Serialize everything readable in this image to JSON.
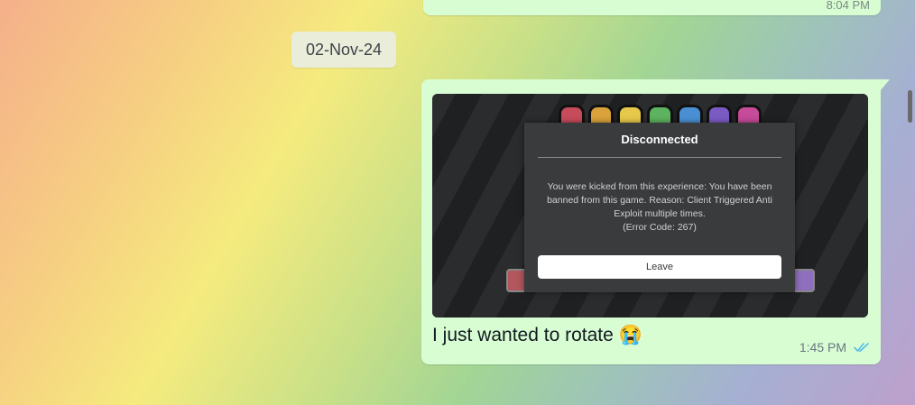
{
  "previous_message": {
    "time": "8:04 PM"
  },
  "date_divider": {
    "label": "02-Nov-24"
  },
  "message": {
    "caption": "I just wanted to rotate 😭",
    "time": "1:45 PM",
    "status": "read",
    "status_icon": "double-check-icon",
    "image": {
      "dialog_title": "Disconnected",
      "dialog_body": "You were kicked from this experience: You have been banned from this game. Reason: Client Triggered Anti Exploit multiple times.",
      "error_code": "(Error Code: 267)",
      "leave_label": "Leave"
    }
  },
  "colors": {
    "bubble": "#d9fdd3",
    "read_ticks": "#53bdeb",
    "dialog_bg": "#393b3d"
  }
}
